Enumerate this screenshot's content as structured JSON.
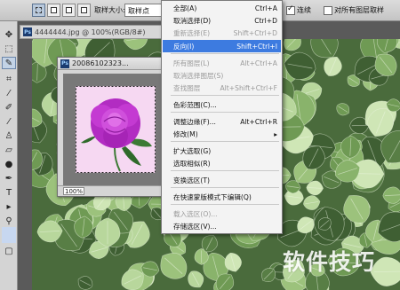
{
  "options_bar": {
    "feather_label": "取样大小:",
    "sample_size_value": "取样点",
    "contiguous_label": "连续",
    "contiguous_checked": true,
    "all_layers_label": "对所有图层取样",
    "all_layers_checked": false
  },
  "background_doc": {
    "badge": "Ps",
    "tab_title": "4444444.jpg @ 100%(RGB/8#)"
  },
  "float_window": {
    "badge": "Ps",
    "title": "20086102323...",
    "zoom": "100%"
  },
  "select_menu": {
    "items": [
      {
        "label": "全部(A)",
        "shortcut": "Ctrl+A",
        "disabled": false,
        "highlight": false
      },
      {
        "label": "取消选择(D)",
        "shortcut": "Ctrl+D",
        "disabled": false,
        "highlight": false
      },
      {
        "label": "重新选择(E)",
        "shortcut": "Shift+Ctrl+D",
        "disabled": true,
        "highlight": false
      },
      {
        "label": "反向(I)",
        "shortcut": "Shift+Ctrl+I",
        "disabled": false,
        "highlight": true
      },
      {
        "label": "所有图层(L)",
        "shortcut": "Alt+Ctrl+A",
        "disabled": true,
        "highlight": false
      },
      {
        "label": "取消选择图层(S)",
        "shortcut": "",
        "disabled": true,
        "highlight": false
      },
      {
        "label": "查找图层",
        "shortcut": "Alt+Shift+Ctrl+F",
        "disabled": true,
        "highlight": false
      },
      {
        "label": "色彩范围(C)...",
        "shortcut": "",
        "disabled": false,
        "highlight": false
      },
      {
        "label": "调整边缘(F)...",
        "shortcut": "Alt+Ctrl+R",
        "disabled": false,
        "highlight": false
      },
      {
        "label": "修改(M)",
        "shortcut": "▸",
        "disabled": false,
        "highlight": false
      },
      {
        "label": "扩大选取(G)",
        "shortcut": "",
        "disabled": false,
        "highlight": false
      },
      {
        "label": "选取相似(R)",
        "shortcut": "",
        "disabled": false,
        "highlight": false
      },
      {
        "label": "变换选区(T)",
        "shortcut": "",
        "disabled": false,
        "highlight": false
      },
      {
        "label": "在快速蒙版模式下编辑(Q)",
        "shortcut": "",
        "disabled": false,
        "highlight": false
      },
      {
        "label": "载入选区(O)...",
        "shortcut": "",
        "disabled": true,
        "highlight": false
      },
      {
        "label": "存储选区(V)...",
        "shortcut": "",
        "disabled": false,
        "highlight": false
      }
    ]
  },
  "watermark": "软件技巧",
  "colors": {
    "highlight": "#3d7be0",
    "flower": "#c030c8",
    "ivy_leaf": "#a9c98e"
  }
}
